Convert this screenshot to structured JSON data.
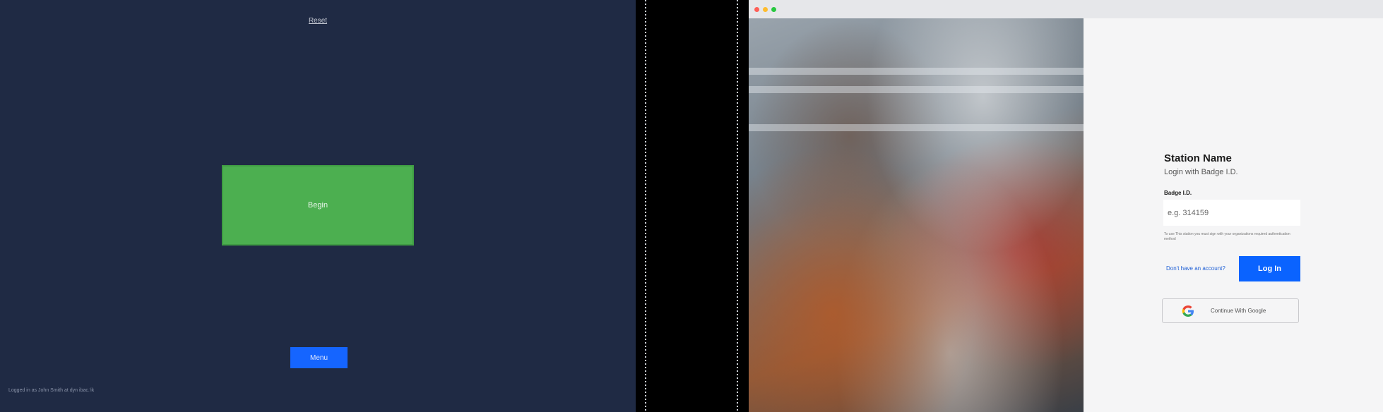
{
  "left": {
    "title": "Reset",
    "begin_label": "Begin",
    "menu_label": "Menu",
    "status": "Logged in as John Smith at dyn ibac.'ik"
  },
  "window": {
    "station_name": "Station Name",
    "subtitle": "Login with Badge I.D.",
    "badge_label": "Badge I.D.",
    "badge_placeholder": "e.g. 314159",
    "note": "To use This station you must sign with your organizations required authentication method",
    "signup_link": "Don't have an account?",
    "login_label": "Log In",
    "google_label": "Continue With Google",
    "colors": {
      "accent": "#0a63ff",
      "begin": "#4caf50",
      "bg": "#1f2a44"
    }
  }
}
